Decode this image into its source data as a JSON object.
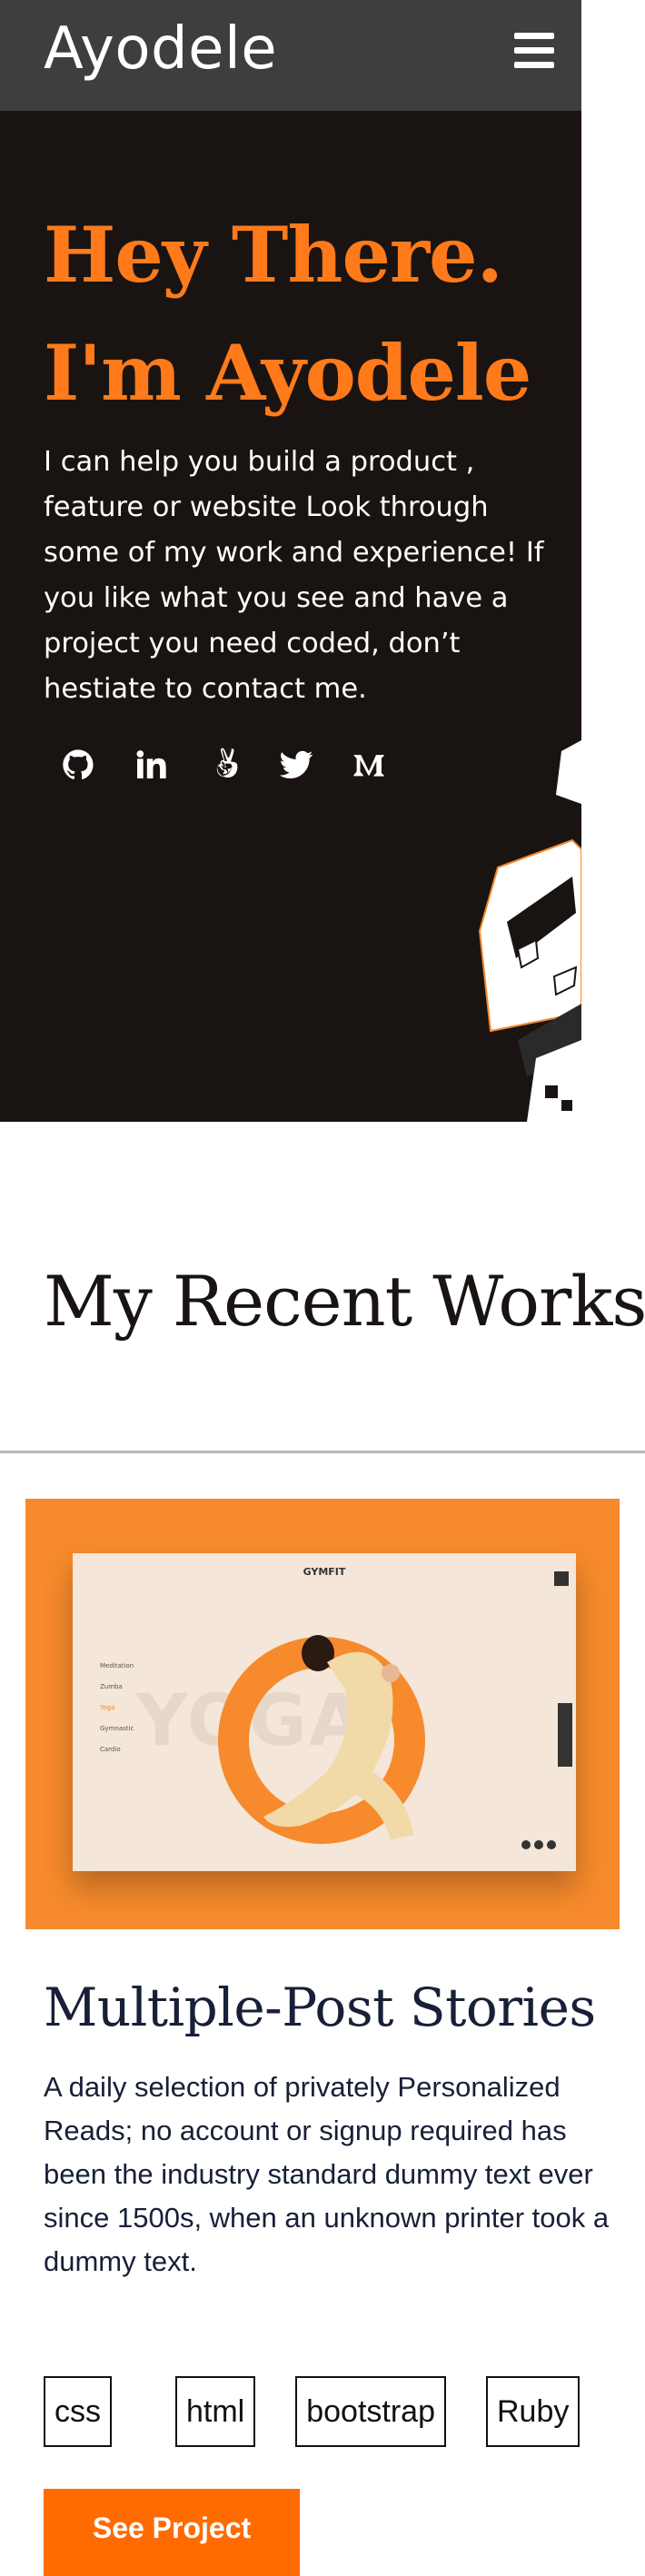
{
  "header": {
    "logo_text": "Ayodele",
    "menu_icon": "hamburger-menu-icon"
  },
  "hero": {
    "title_line1": "Hey There.",
    "title_line2": "I'm Ayodele",
    "intro": "I can help you build a product , feature or website Look through some of my work and experience! If you like what you see and have a project you need coded, don’t hestiate to contact me.",
    "socials": [
      {
        "name": "github",
        "icon": "github-icon"
      },
      {
        "name": "linkedin",
        "icon": "linkedin-icon"
      },
      {
        "name": "angellist",
        "icon": "angellist-icon"
      },
      {
        "name": "twitter",
        "icon": "twitter-icon"
      },
      {
        "name": "medium",
        "icon": "medium-icon"
      }
    ]
  },
  "works": {
    "title": "My Recent Works",
    "project": {
      "preview": {
        "brand": "GYMFIT",
        "watermark": "YOGA",
        "menu": [
          "Meditation",
          "Zumba",
          "Yoga",
          "Gymnastic",
          "Cardio"
        ],
        "active_menu": "Yoga"
      },
      "title": "Multiple-Post Stories",
      "description": "A daily selection of privately Personalized Reads; no account or signup required has been the industry standard dummy text ever since 1500s, when an unknown printer took a dummy text.",
      "tags": [
        "css",
        "html",
        "bootstrap",
        "Ruby"
      ],
      "button_label": "See Project"
    }
  },
  "colors": {
    "accent": "#ff7a1a",
    "hero_bg": "#191412",
    "header_bg": "#3f3e3e",
    "heading_dark": "#172037",
    "button_bg": "#ff6b00"
  }
}
